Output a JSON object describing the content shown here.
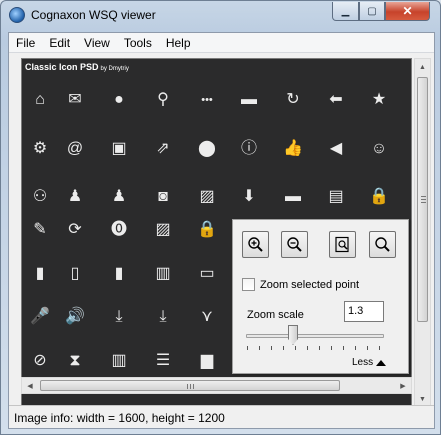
{
  "window": {
    "title": "Cognaxon WSQ viewer",
    "min_glyph": "▁",
    "max_glyph": "▢",
    "close_glyph": "✕"
  },
  "menu": [
    "File",
    "Edit",
    "View",
    "Tools",
    "Help"
  ],
  "image": {
    "header": "Classic Icon PSD",
    "byline": "by Dmytriy",
    "icons": [
      [
        "home-icon",
        "mail-icon",
        "user-icon",
        "search-icon",
        "more-icon",
        "chat-icon",
        "refresh-icon",
        "arrow-left-icon",
        "star-icon"
      ],
      [
        "gear-icon",
        "at-icon",
        "save-icon",
        "share-icon",
        "location-pin-icon",
        "info-icon",
        "thumbs-up-icon",
        "megaphone-icon",
        "smiley-icon"
      ],
      [
        "users-icon",
        "user-check-icon",
        "user-heart-icon",
        "camera-icon",
        "picture-icon",
        "download-box-icon",
        "folder-icon",
        "comments-icon",
        "lock-icon"
      ],
      [
        "edit-icon",
        "sync-icon",
        "exclamation-circle-icon",
        "image-icon",
        "lock-gear-icon"
      ],
      [
        "bookmark-icon",
        "document-icon",
        "documents-icon",
        "book-icon",
        "inbox-icon"
      ],
      [
        "microphone-icon",
        "volume-icon",
        "download-icon",
        "download-gear-icon",
        "network-icon"
      ],
      [
        "forbidden-icon",
        "hourglass-icon",
        "columns-icon",
        "list-icon",
        "bar-chart-icon"
      ]
    ]
  },
  "zoom_panel": {
    "buttons": [
      "zoom-in-icon",
      "zoom-out-icon",
      "zoom-fit-icon",
      "zoom-actual-icon"
    ],
    "checkbox_label": "Zoom selected point",
    "checkbox_checked": false,
    "scale_label": "Zoom scale",
    "scale_value": "1.3",
    "less_label": "Less"
  },
  "status": {
    "text": "Image info: width = 1600, height = 1200"
  }
}
